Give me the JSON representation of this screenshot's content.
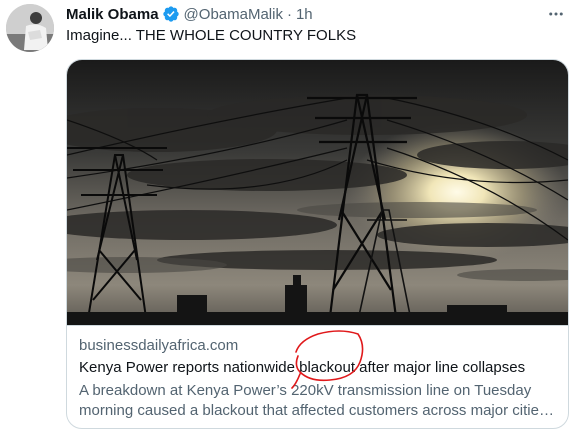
{
  "tweet": {
    "author_name": "Malik Obama",
    "handle": "@ObamaMalik",
    "separator": "·",
    "time": "1h",
    "text": "Imagine... THE WHOLE COUNTRY FOLKS"
  },
  "icons": {
    "verified": "verified-badge-icon",
    "more": "more-options-icon"
  },
  "colors": {
    "verified_blue": "#1d9bf0",
    "secondary_text": "#536471",
    "annotation_red": "#e0191b"
  },
  "card": {
    "domain": "businessdailyafrica.com",
    "title": "Kenya Power reports nationwide blackout after major line collapses",
    "description": "A breakdown at Kenya Power’s 220kV transmission line on Tuesday morning caused a blackout that affected customers across major citie…"
  }
}
